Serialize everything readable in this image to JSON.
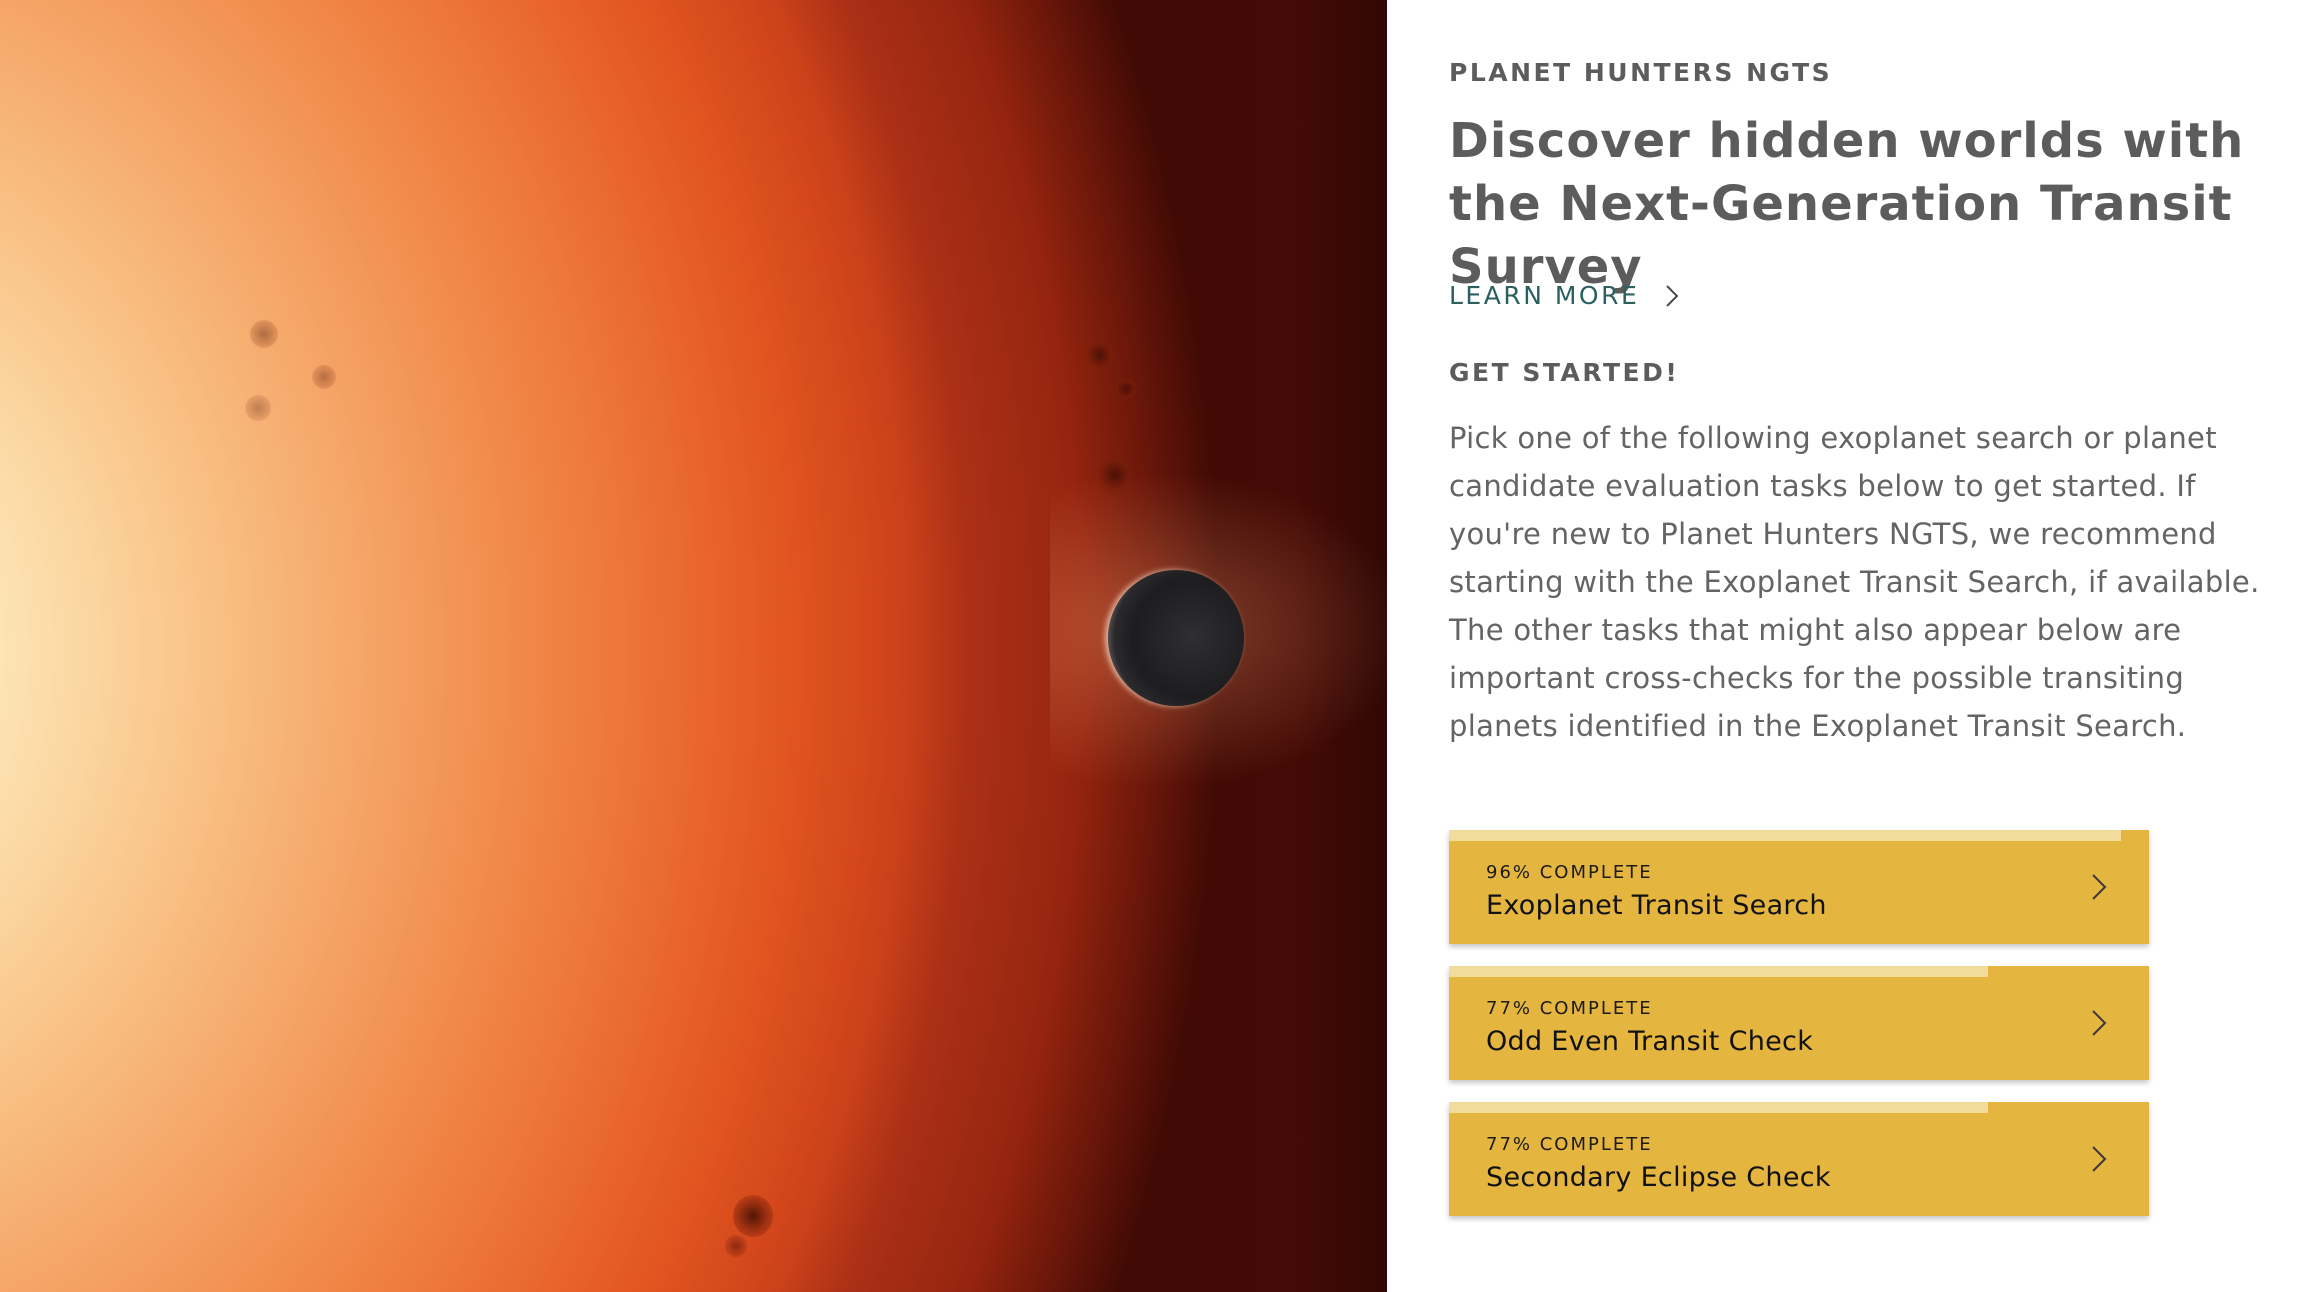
{
  "project": {
    "eyebrow": "PLANET HUNTERS NGTS",
    "headline": "Discover hidden worlds with the Next-Generation Transit Survey",
    "learn_more": "LEARN MORE"
  },
  "get_started": {
    "heading": "GET STARTED!",
    "body": "Pick one of the following exoplanet search or planet candidate evaluation tasks below to get started. If you're new to Planet Hunters NGTS, we recommend starting with the Exoplanet Transit Search, if available. The other tasks that might also appear below are important cross-checks for the possible transiting planets identified in the Exoplanet Transit Search."
  },
  "tasks": [
    {
      "completion_label": "96% COMPLETE",
      "name": "Exoplanet Transit Search",
      "progress": 0.96
    },
    {
      "completion_label": "77% COMPLETE",
      "name": "Odd Even Transit Check",
      "progress": 0.77
    },
    {
      "completion_label": "77% COMPLETE",
      "name": "Secondary Eclipse Check",
      "progress": 0.77
    }
  ],
  "icons": {
    "learn_more": "chevron-right-icon",
    "task": "chevron-right-icon"
  },
  "colors": {
    "task_background": "#e5b63f",
    "task_progress": "#f2dc9c",
    "link": "#2c5f5f",
    "heading_text": "#5c5c5c"
  }
}
